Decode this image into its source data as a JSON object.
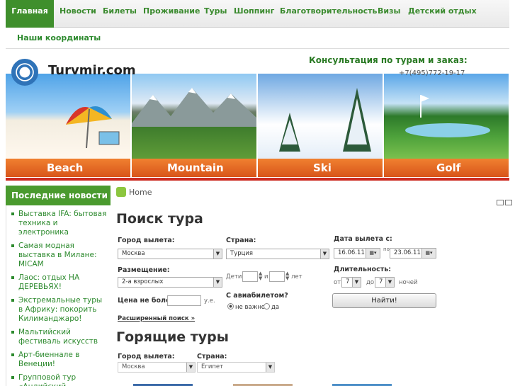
{
  "nav": {
    "items": [
      "Главная",
      "Новости",
      "Билеты",
      "Проживание",
      "Туры",
      "Шоппинг",
      "Благотворительность",
      "Визы",
      "Детский отдых"
    ],
    "second_row": "Наши координаты"
  },
  "header": {
    "logo_text": "Turvmir.com",
    "consult_text": "Консультация по турам и заказ:",
    "phone": "+7(495)772-19-17",
    "panels": [
      "Beach",
      "Mountain",
      "Ski",
      "Golf"
    ]
  },
  "sidebar": {
    "title": "Последние новости",
    "news": [
      "Выставка IFA: бытовая техника и электроника",
      "Самая модная выставка в Милане: MICAM",
      "Лаос: отдых НА ДЕРЕВЬЯХ!",
      "Экстремальные туры в Африку: покорить Килиманджаро!",
      "Мальтийский фестиваль искусств",
      "Арт-биеннале в Венеции!",
      "Групповой тур «Андийский экспресс»"
    ]
  },
  "breadcrumb": "Home",
  "search": {
    "title": "Поиск тура",
    "city_label": "Город вылета:",
    "city_value": "Москва",
    "country_label": "Страна:",
    "country_value": "Турция",
    "date_label": "Дата вылета с:",
    "date_from": "16.06.11",
    "date_to_label": "по",
    "date_to": "23.06.11",
    "accom_label": "Размещение:",
    "accom_value": "2-а взрослых",
    "children_label": "Дети:",
    "children_and": "и",
    "children_years": "лет",
    "duration_label": "Длительность:",
    "duration_from_label": "от",
    "duration_from": "7",
    "duration_to_label": "до",
    "duration_to": "7",
    "duration_unit": "ночей",
    "price_label": "Цена не более:",
    "price_unit": "у.е.",
    "ticket_label": "С авиабилетом?",
    "ticket_opt1": "не важно",
    "ticket_opt2": "да",
    "submit": "Найти!",
    "advanced": "Расширенный поиск »"
  },
  "hot": {
    "title": "Горящие туры",
    "city_label": "Город вылета:",
    "city_value": "Москва",
    "country_label": "Страна:",
    "country_value": "Египет"
  }
}
